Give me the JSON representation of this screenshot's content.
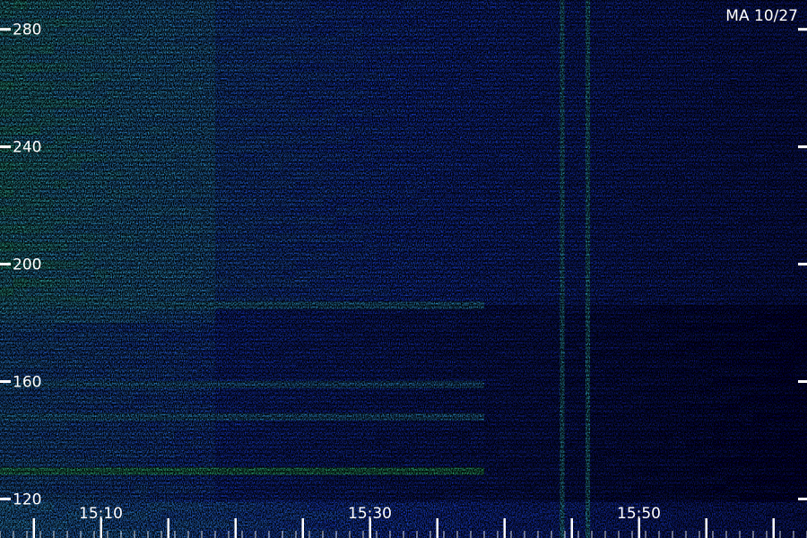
{
  "chart_data": {
    "type": "heatmap",
    "title": "MA 10/27",
    "xlabel": "",
    "ylabel": "",
    "x_ticks": [
      "15:10",
      "15:30",
      "15:50"
    ],
    "x_tick_minutes": [
      10,
      30,
      50
    ],
    "x_range_minutes": [
      2.5,
      62.5
    ],
    "y_ticks": [
      280,
      240,
      200,
      160,
      120
    ],
    "y_range": [
      106.7,
      290
    ],
    "grid": false,
    "legend": "none",
    "colors": {
      "background": "#000000",
      "low": "#0a0a6e",
      "mid": "#1e4bff",
      "high": "#3ab8ff",
      "peak": "#3cff7a",
      "text": "#ffffff"
    },
    "vertical_lines_minutes": [
      44.3,
      46.2
    ],
    "horizontal_bands": [
      {
        "freq": 129.5,
        "strength": 0.9
      },
      {
        "freq": 148,
        "strength": 0.45
      },
      {
        "freq": 159,
        "strength": 0.4
      },
      {
        "freq": 186,
        "strength": 0.5
      }
    ]
  }
}
